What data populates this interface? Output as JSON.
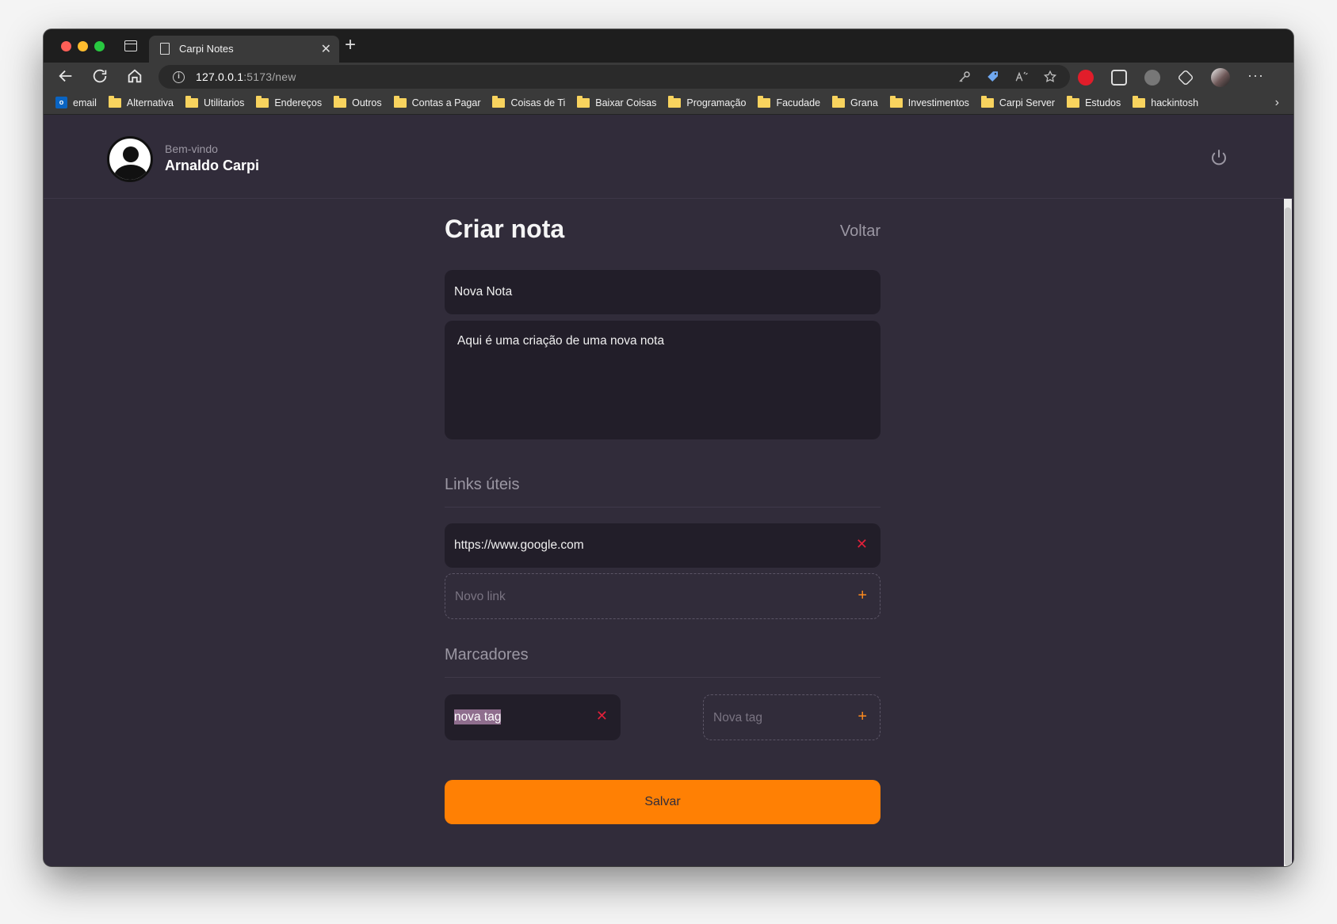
{
  "browser": {
    "tab_title": "Carpi Notes",
    "url_host": "127.0.0.1",
    "url_path": ":5173/new",
    "bookmarks": [
      {
        "label": "email",
        "icon": "outlook-icon"
      },
      {
        "label": "Alternativa",
        "icon": "folder-icon"
      },
      {
        "label": "Utilitarios",
        "icon": "folder-icon"
      },
      {
        "label": "Endereços",
        "icon": "folder-icon"
      },
      {
        "label": "Outros",
        "icon": "folder-icon"
      },
      {
        "label": "Contas a Pagar",
        "icon": "folder-icon"
      },
      {
        "label": "Coisas de Ti",
        "icon": "folder-icon"
      },
      {
        "label": "Baixar Coisas",
        "icon": "folder-icon"
      },
      {
        "label": "Programação",
        "icon": "folder-icon"
      },
      {
        "label": "Facudade",
        "icon": "folder-icon"
      },
      {
        "label": "Grana",
        "icon": "folder-icon"
      },
      {
        "label": "Investimentos",
        "icon": "folder-icon"
      },
      {
        "label": "Carpi Server",
        "icon": "folder-icon"
      },
      {
        "label": "Estudos",
        "icon": "folder-icon"
      },
      {
        "label": "hackintosh",
        "icon": "folder-icon"
      }
    ]
  },
  "header": {
    "welcome": "Bem-vindo",
    "username": "Arnaldo Carpi"
  },
  "form": {
    "title": "Criar nota",
    "back": "Voltar",
    "note_title_value": "Nova Nota",
    "note_body_value": "Aqui é uma criação de uma nova nota",
    "links_section": "Links úteis",
    "links": [
      "https://www.google.com"
    ],
    "new_link_placeholder": "Novo link",
    "tags_section": "Marcadores",
    "tags": [
      "nova tag"
    ],
    "new_tag_placeholder": "Nova tag",
    "save": "Salvar"
  },
  "colors": {
    "accent": "#ff8004",
    "background": "#312c3a",
    "input_bg": "#221e29",
    "remove": "#e0203a"
  }
}
